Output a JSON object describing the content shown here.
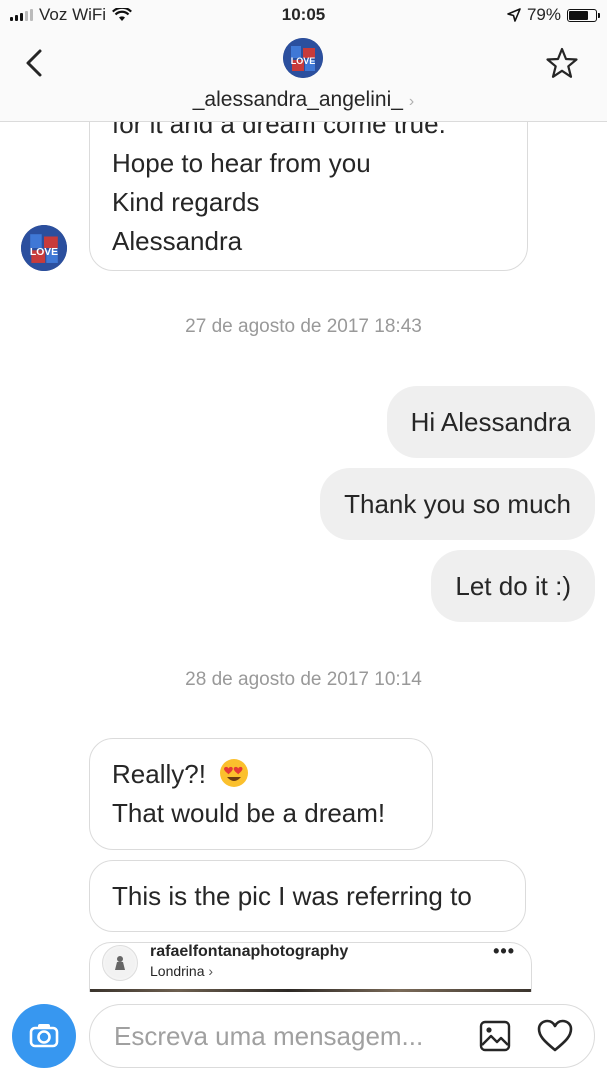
{
  "status_bar": {
    "carrier": "Voz WiFi",
    "time": "10:05",
    "battery_percent": "79%",
    "battery_level": 0.79
  },
  "header": {
    "username": "_alessandra_angelini_",
    "chevron": "›",
    "icons": {
      "back": "chevron-left-icon",
      "favorite": "star-icon",
      "avatar": "profile-avatar"
    }
  },
  "messages": {
    "first_lines": [
      "for it and a dream come true.",
      "Hope to hear from you",
      "Kind regards",
      "Alessandra"
    ],
    "timestamp_1": "27 de agosto de 2017 18:43",
    "outgoing": [
      "Hi Alessandra",
      "Thank you so much",
      "Let do it :)"
    ],
    "timestamp_2": "28 de agosto de 2017 10:14",
    "reply_line_1": "Really?!",
    "reply_emoji": "heart-eyes-emoji",
    "reply_line_2": "That would be a dream!",
    "pic_line": "This is the pic I was referring to"
  },
  "shared_post": {
    "username": "rafaelfontanaphotography",
    "location": "Londrina",
    "chevron": "›",
    "more": "•••"
  },
  "composer": {
    "placeholder": "Escreva uma mensagem...",
    "icons": {
      "camera": "camera-icon",
      "gallery": "gallery-icon",
      "like": "heart-icon"
    }
  },
  "colors": {
    "accent": "#3797f0",
    "outgoing_bubble": "#efefef",
    "border": "#dbdbdb",
    "timestamp": "#999999"
  }
}
